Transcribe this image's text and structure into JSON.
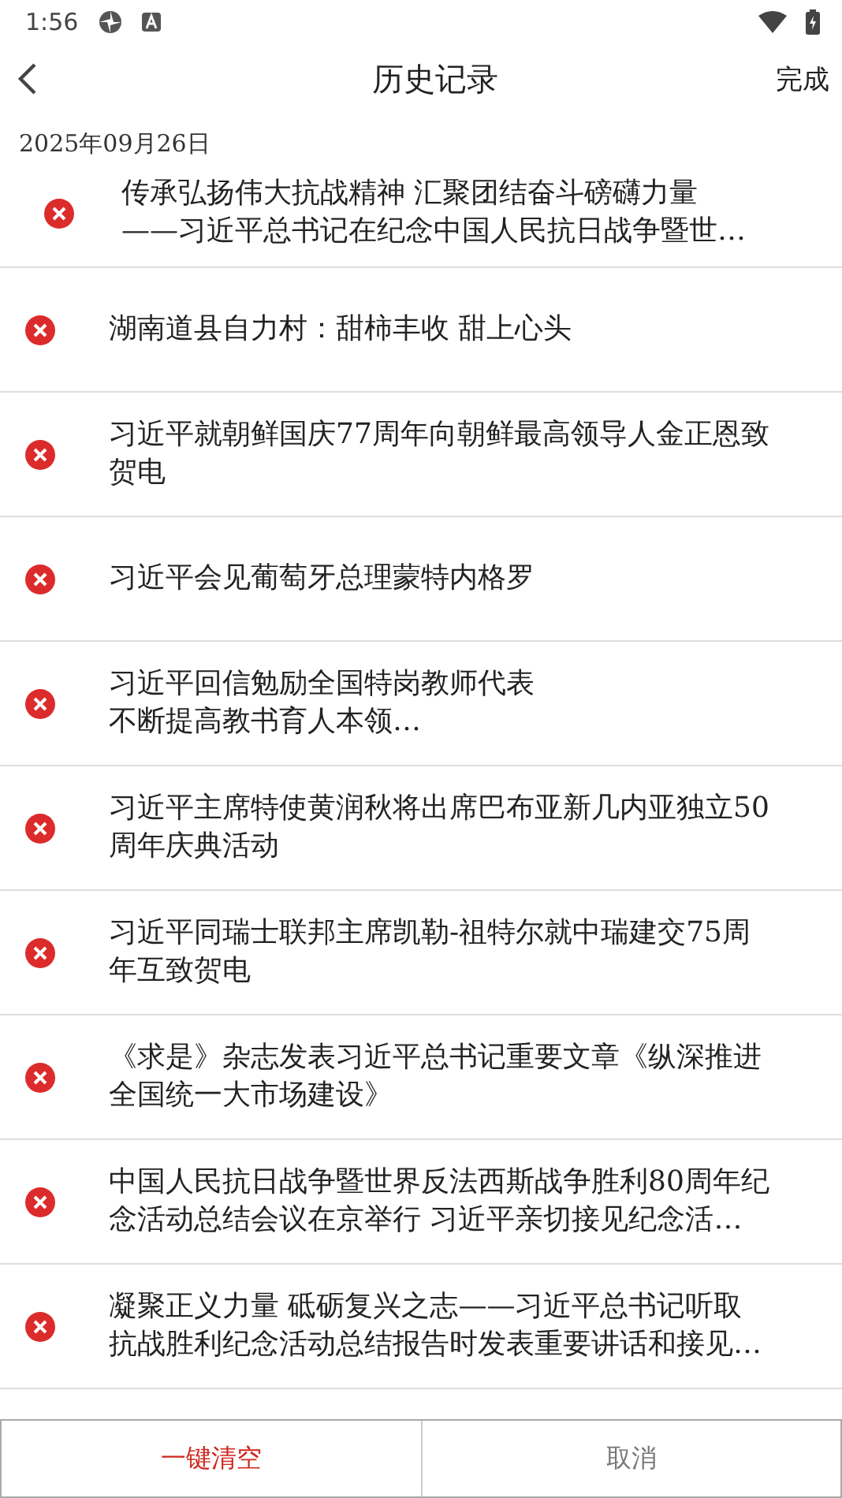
{
  "status_bar": {
    "time": "1:56"
  },
  "header": {
    "title": "历史记录",
    "action": "完成"
  },
  "date": "2025年09月26日",
  "items": [
    {
      "lines": [
        "传承弘扬伟大抗战精神  汇聚团结奋斗磅礴力量",
        "——习近平总书记在纪念中国人民抗日战争暨世…"
      ]
    },
    {
      "lines": [
        "湖南道县自力村：甜柿丰收  甜上心头"
      ]
    },
    {
      "lines": [
        "习近平就朝鲜国庆77周年向朝鲜最高领导人金正恩致",
        "贺电"
      ]
    },
    {
      "lines": [
        "习近平会见葡萄牙总理蒙特内格罗"
      ]
    },
    {
      "lines": [
        "习近平回信勉励全国特岗教师代表",
        "不断提高教书育人本领…"
      ]
    },
    {
      "lines": [
        "习近平主席特使黄润秋将出席巴布亚新几内亚独立50",
        "周年庆典活动"
      ]
    },
    {
      "lines": [
        "习近平同瑞士联邦主席凯勒-祖特尔就中瑞建交75周",
        "年互致贺电"
      ]
    },
    {
      "lines": [
        "《求是》杂志发表习近平总书记重要文章《纵深推进",
        "全国统一大市场建设》"
      ]
    },
    {
      "lines": [
        "中国人民抗日战争暨世界反法西斯战争胜利80周年纪",
        "念活动总结会议在京举行  习近平亲切接见纪念活…"
      ]
    },
    {
      "lines": [
        "凝聚正义力量  砥砺复兴之志——习近平总书记听取",
        "抗战胜利纪念活动总结报告时发表重要讲话和接见…"
      ]
    }
  ],
  "buttons": [
    {
      "label": "一键清空",
      "kind": "danger"
    },
    {
      "label": "取消",
      "kind": "normal"
    }
  ]
}
